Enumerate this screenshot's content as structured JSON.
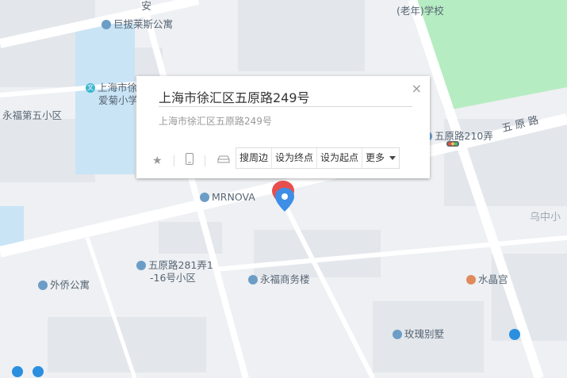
{
  "popup": {
    "title": "上海市徐汇区五原路249号",
    "address": "上海市徐汇区五原路249号",
    "close_symbol": "×",
    "icons": [
      "star-icon",
      "phone-icon",
      "car-icon"
    ],
    "actions": [
      "搜周边",
      "设为终点",
      "设为起点",
      "更多"
    ]
  },
  "pois": [
    {
      "label": "巨拔莱斯公寓"
    },
    {
      "label": "上海市徐"
    },
    {
      "label": "爱菊小学"
    },
    {
      "label": "永福第五小区"
    },
    {
      "label": "(老年)学校"
    },
    {
      "label": "五原路210弄"
    },
    {
      "label": "MRNOVA"
    },
    {
      "label": "五原路281弄1"
    },
    {
      "label": "-16号小区"
    },
    {
      "label": "外侨公寓"
    },
    {
      "label": "永福商务楼"
    },
    {
      "label": "水晶宫"
    },
    {
      "label": "玫瑰别墅"
    },
    {
      "label": "乌中小"
    }
  ],
  "roads": [
    {
      "label": "五 原 路"
    },
    {
      "label": "安"
    }
  ],
  "colors": {
    "map_bg": "#eef0f3",
    "road": "#ffffff",
    "green_area": "#b6ecc1",
    "water_area": "#c9e4f5",
    "marker_red": "#e84e4e",
    "marker_blue": "#3d8ee6"
  }
}
